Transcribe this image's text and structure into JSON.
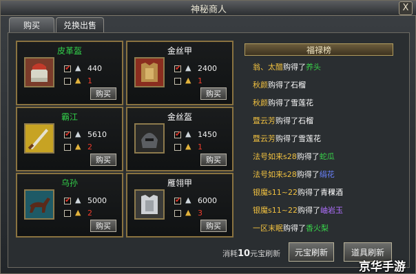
{
  "window": {
    "title": "神秘商人",
    "close": "X"
  },
  "tabs": [
    {
      "label": "购买"
    },
    {
      "label": "兑换出售"
    }
  ],
  "items": [
    {
      "name": "皮革盔",
      "name_color": "#32d14a",
      "silver": "440",
      "gold": "1",
      "buy": "购买"
    },
    {
      "name": "金丝甲",
      "name_color": "#ffffff",
      "silver": "2400",
      "gold": "1",
      "buy": "购买"
    },
    {
      "name": "霸江",
      "name_color": "#32d14a",
      "silver": "5610",
      "gold": "2",
      "buy": "购买"
    },
    {
      "name": "金丝盔",
      "name_color": "#ffffff",
      "silver": "1450",
      "gold": "1",
      "buy": "购买"
    },
    {
      "name": "乌孙",
      "name_color": "#32d14a",
      "silver": "5000",
      "gold": "2",
      "buy": "购买"
    },
    {
      "name": "雁翎甲",
      "name_color": "#ffffff",
      "silver": "6000",
      "gold": "3",
      "buy": "购买"
    }
  ],
  "fulu": {
    "title": "福禄榜",
    "entries": [
      {
        "who": "翁、太醋",
        "verb": "购得了",
        "item": "养头",
        "item_color": "#38d24a"
      },
      {
        "who": "秋颜",
        "verb": "购得了",
        "item": "石榴",
        "item_color": "#ffffff"
      },
      {
        "who": "秋颜",
        "verb": "购得了",
        "item": "雪莲花",
        "item_color": "#ffffff"
      },
      {
        "who": "暨云芳",
        "verb": "购得了",
        "item": "石榴",
        "item_color": "#ffffff"
      },
      {
        "who": "暨云芳",
        "verb": "购得了",
        "item": "雪莲花",
        "item_color": "#ffffff"
      },
      {
        "who": "法号如来s28",
        "verb": "购得了",
        "item": "蛇瓜",
        "item_color": "#38d24a"
      },
      {
        "who": "法号如来s28",
        "verb": "购得了",
        "item": "绢花",
        "item_color": "#6a82ff"
      },
      {
        "who": "银魔s11~22",
        "verb": "购得了",
        "item": "青稞酒",
        "item_color": "#ffffff"
      },
      {
        "who": "银魔s11~22",
        "verb": "购得了",
        "item": "岫岩玉",
        "item_color": "#b070ff"
      },
      {
        "who": "一区末眠",
        "verb": "购得了",
        "item": "香火梨",
        "item_color": "#38d24a"
      }
    ],
    "who_color": "#f0c040"
  },
  "footer": {
    "cost_prefix": "消耗",
    "cost_amount": "10",
    "cost_suffix": "元宝刷新",
    "btn_yuanbao": "元宝刷新",
    "btn_daoju": "道具刷新"
  },
  "watermark": "京华手游"
}
